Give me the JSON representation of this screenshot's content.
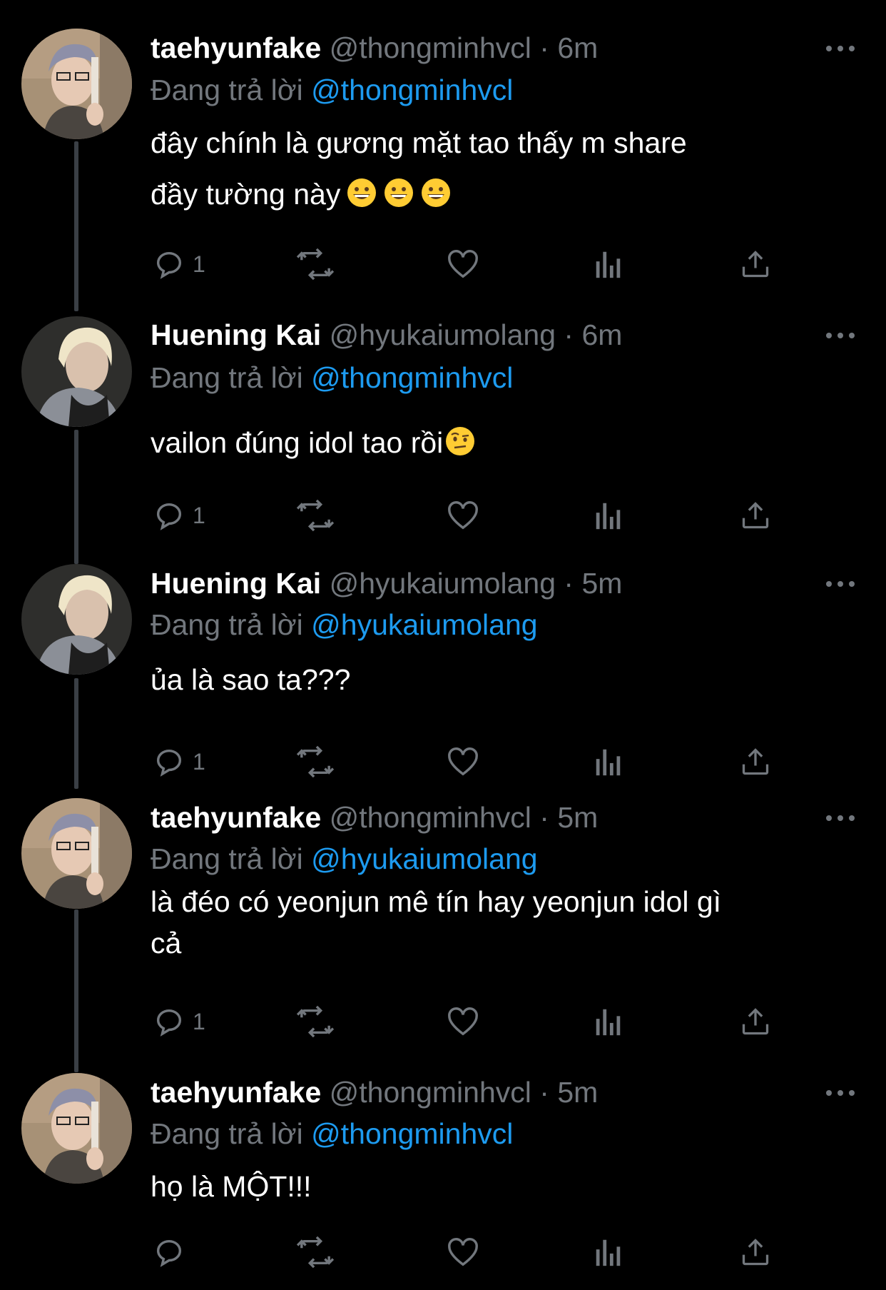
{
  "reply_prefix": "Đang trả lời",
  "tweets": [
    {
      "name": "taehyunfake",
      "handle": "@thongminhvcl",
      "dot": "·",
      "time": "6m",
      "reply_to": "@thongminhvcl",
      "text_lines": [
        "đây chính là gương mặt tao thấy m share",
        "đầy tường này"
      ],
      "emojis": [
        "grinning-face-emoji",
        "grinning-face-emoji",
        "grinning-face-emoji"
      ],
      "reply_count": "1"
    },
    {
      "name": "Huening Kai",
      "handle": "@hyukaiumolang",
      "dot": "·",
      "time": "6m",
      "reply_to": "@thongminhvcl",
      "text_lines": [
        "vailon đúng idol tao rồi"
      ],
      "emojis": [
        "face-with-raised-eyebrow-emoji"
      ],
      "reply_count": "1"
    },
    {
      "name": "Huening Kai",
      "handle": "@hyukaiumolang",
      "dot": "·",
      "time": "5m",
      "reply_to": "@hyukaiumolang",
      "text_lines": [
        "ủa là sao ta???"
      ],
      "emojis": [],
      "reply_count": "1"
    },
    {
      "name": "taehyunfake",
      "handle": "@thongminhvcl",
      "dot": "·",
      "time": "5m",
      "reply_to": "@hyukaiumolang",
      "text_lines": [
        "là đéo có yeonjun mê tín hay yeonjun idol gì",
        "cả"
      ],
      "emojis": [],
      "reply_count": "1"
    },
    {
      "name": "taehyunfake",
      "handle": "@thongminhvcl",
      "dot": "·",
      "time": "5m",
      "reply_to": "@thongminhvcl",
      "text_lines": [
        "họ là MỘT!!!"
      ],
      "emojis": [],
      "reply_count": ""
    }
  ],
  "icons": {
    "reply": "reply-icon",
    "retweet": "retweet-icon",
    "like": "like-icon",
    "analytics": "analytics-icon",
    "share": "share-icon",
    "more": "more-icon"
  },
  "colors": {
    "background": "#000000",
    "secondary_text": "#72777d",
    "link": "#1d9bf0",
    "thread_line": "#3a3f45"
  }
}
